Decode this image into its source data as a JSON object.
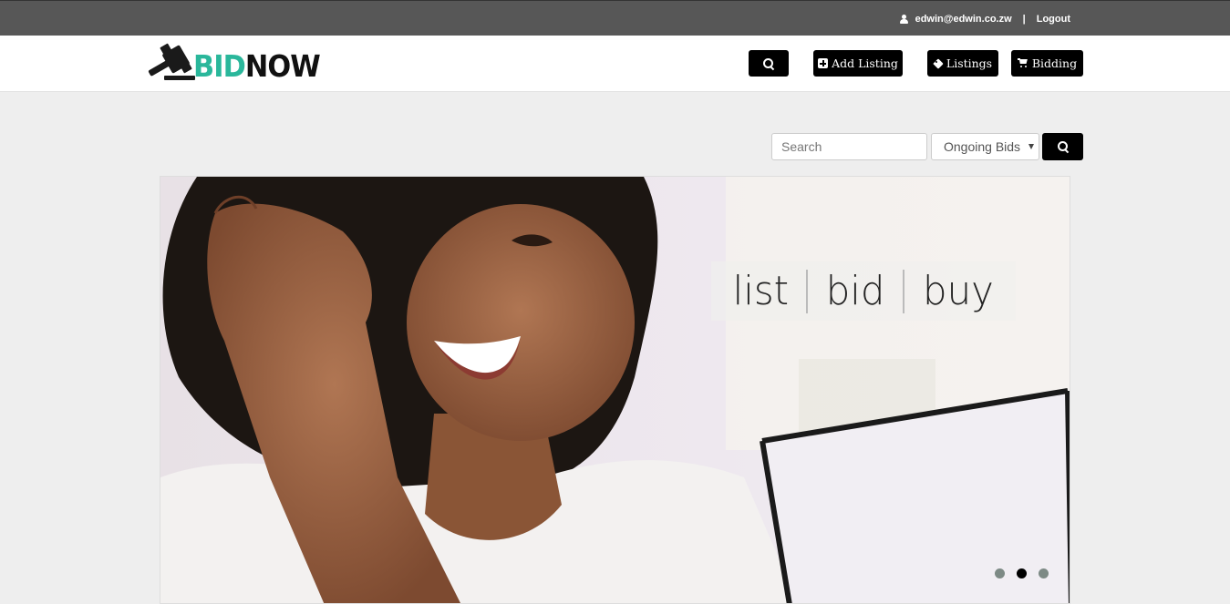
{
  "topbar": {
    "user_email": "edwin@edwin.co.zw",
    "separator": "|",
    "logout_label": "Logout"
  },
  "navbar": {
    "logo": {
      "part1": "BID",
      "part2": "NOW"
    },
    "search_icon": "search-icon",
    "add_listing_label": "Add Listing",
    "listings_label": "Listings",
    "bidding_label": "Bidding"
  },
  "search": {
    "placeholder": "Search",
    "filter_selected": "Ongoing Bids"
  },
  "carousel": {
    "words": [
      "list",
      "bid",
      "buy"
    ],
    "active_slide": 2,
    "total_slides": 3
  },
  "colors": {
    "topbar": "#575757",
    "brand_green": "#2ab79b",
    "button": "#000000"
  }
}
